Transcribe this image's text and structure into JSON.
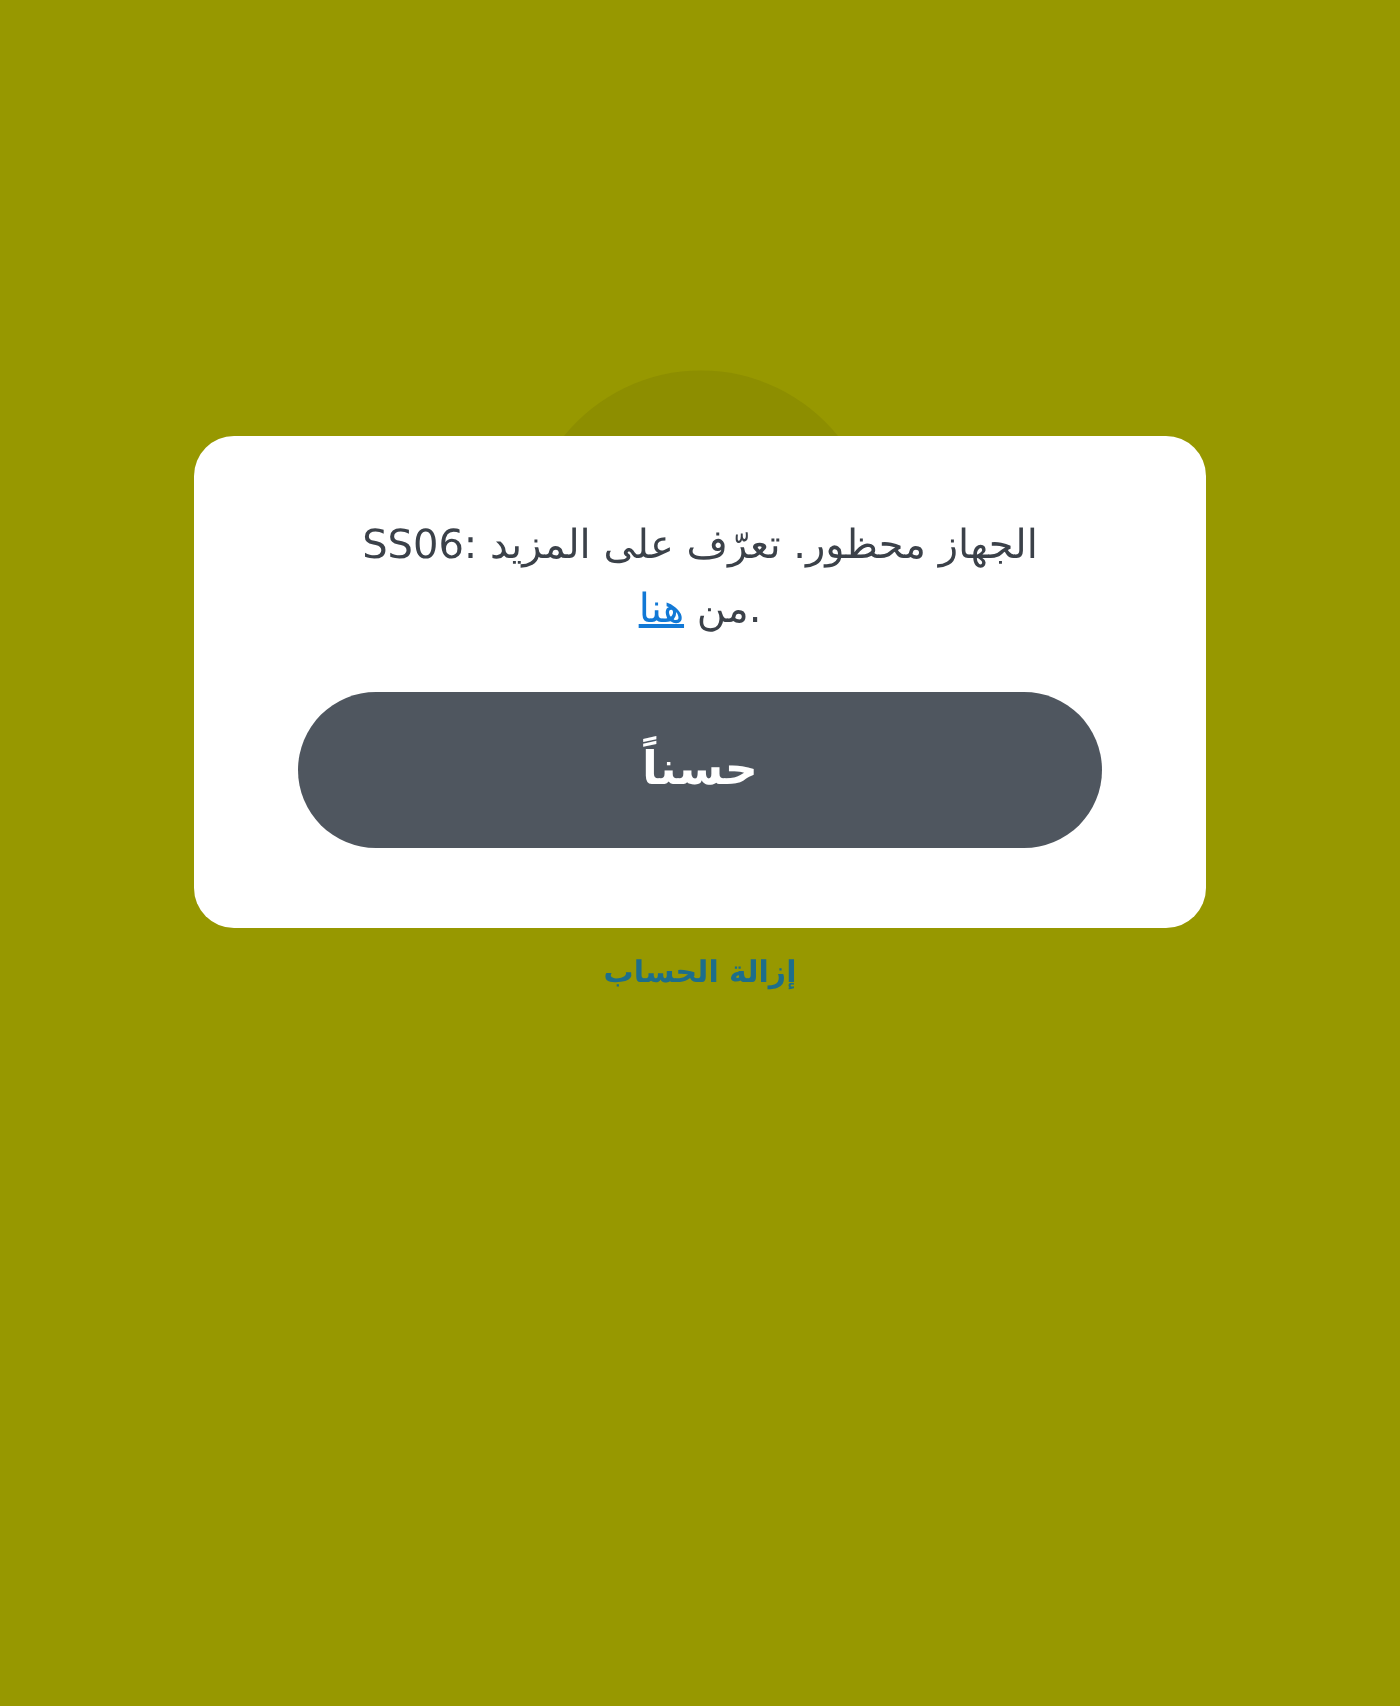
{
  "dialog": {
    "message": "SS06: الجهاز محظور. تعرّف على المزيد",
    "link_prefix": "من",
    "link": "هنا",
    "link_suffix": ".",
    "button": "حسناً"
  },
  "remove_account_link": "إزالة الحساب"
}
